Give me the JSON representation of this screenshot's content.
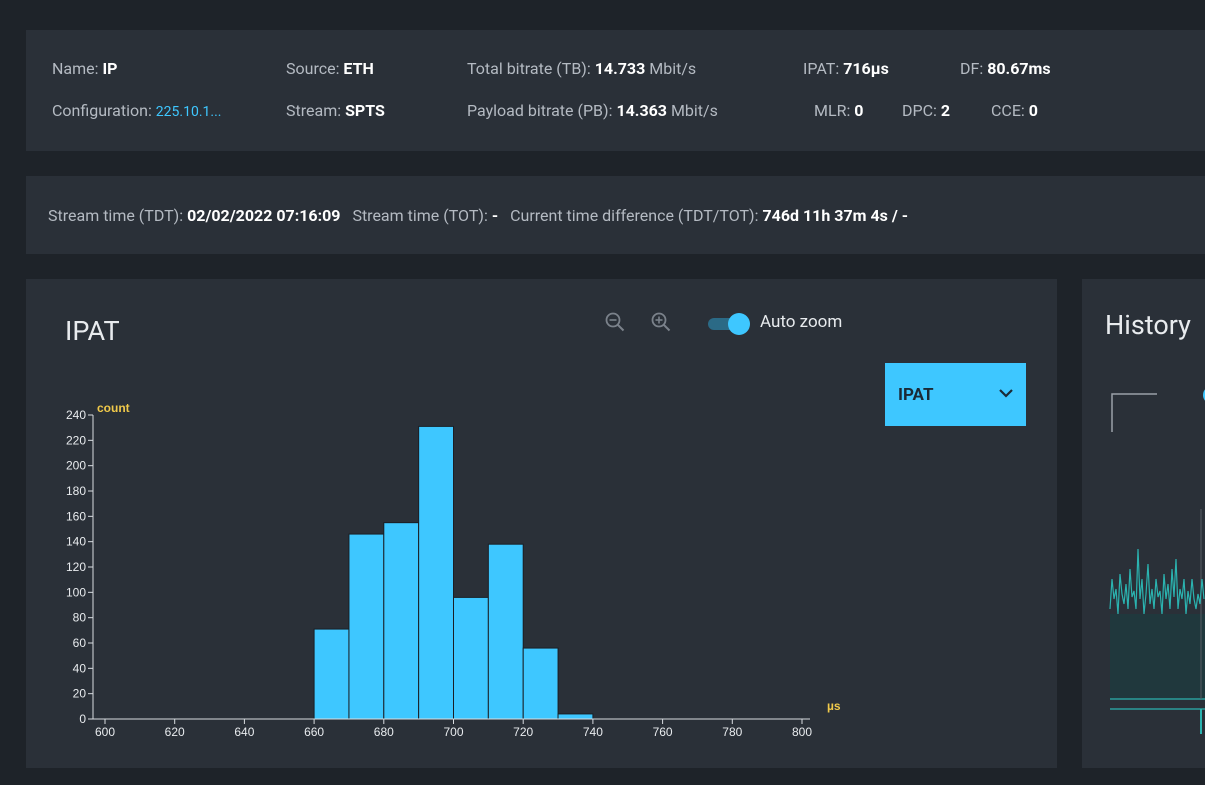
{
  "info": {
    "name_label": "Name:",
    "name_value": "IP",
    "source_label": "Source:",
    "source_value": "ETH",
    "tb_label": "Total bitrate (TB):",
    "tb_value": "14.733",
    "tb_unit": "Mbit/s",
    "ipat_label": "IPAT:",
    "ipat_value": "716µs",
    "df_label": "DF:",
    "df_value": "80.67ms",
    "config_label": "Configuration:",
    "config_value": "225.10.1...",
    "stream_label": "Stream:",
    "stream_value": "SPTS",
    "pb_label": "Payload bitrate (PB):",
    "pb_value": "14.363",
    "pb_unit": "Mbit/s",
    "mlr_label": "MLR:",
    "mlr_value": "0",
    "dpc_label": "DPC:",
    "dpc_value": "2",
    "cce_label": "CCE:",
    "cce_value": "0"
  },
  "time": {
    "tdt_label": "Stream time (TDT):",
    "tdt_value": "02/02/2022 07:16:09",
    "tot_label": "Stream time (TOT):",
    "tot_value": "-",
    "diff_label": "Current time difference (TDT/TOT):",
    "diff_value": "746d 11h 37m 4s / -"
  },
  "ipat_panel": {
    "title": "IPAT",
    "auto_zoom_label": "Auto zoom",
    "auto_zoom_on": true,
    "metric_select": "IPAT"
  },
  "history_panel": {
    "title": "History"
  },
  "colors": {
    "accent": "#3ec7ff",
    "axis_label": "#f0c94a",
    "card": "#2a3038",
    "background": "#1e2329"
  },
  "icons": [
    "zoom-out-icon",
    "zoom-in-icon",
    "chevron-down-icon"
  ],
  "chart_data": {
    "type": "bar",
    "xlabel": "µs",
    "ylabel": "count",
    "xlim": [
      600,
      800
    ],
    "ylim": [
      0,
      240
    ],
    "x_ticks": [
      600,
      620,
      640,
      660,
      680,
      700,
      720,
      740,
      760,
      780,
      800
    ],
    "y_ticks": [
      0,
      20,
      40,
      60,
      80,
      100,
      120,
      140,
      160,
      180,
      200,
      220,
      240
    ],
    "bin_width": 10,
    "bins": [
      {
        "start": 660,
        "value": 71
      },
      {
        "start": 670,
        "value": 146
      },
      {
        "start": 680,
        "value": 155
      },
      {
        "start": 690,
        "value": 231
      },
      {
        "start": 700,
        "value": 96
      },
      {
        "start": 710,
        "value": 138
      },
      {
        "start": 720,
        "value": 56
      },
      {
        "start": 730,
        "value": 4
      }
    ]
  }
}
